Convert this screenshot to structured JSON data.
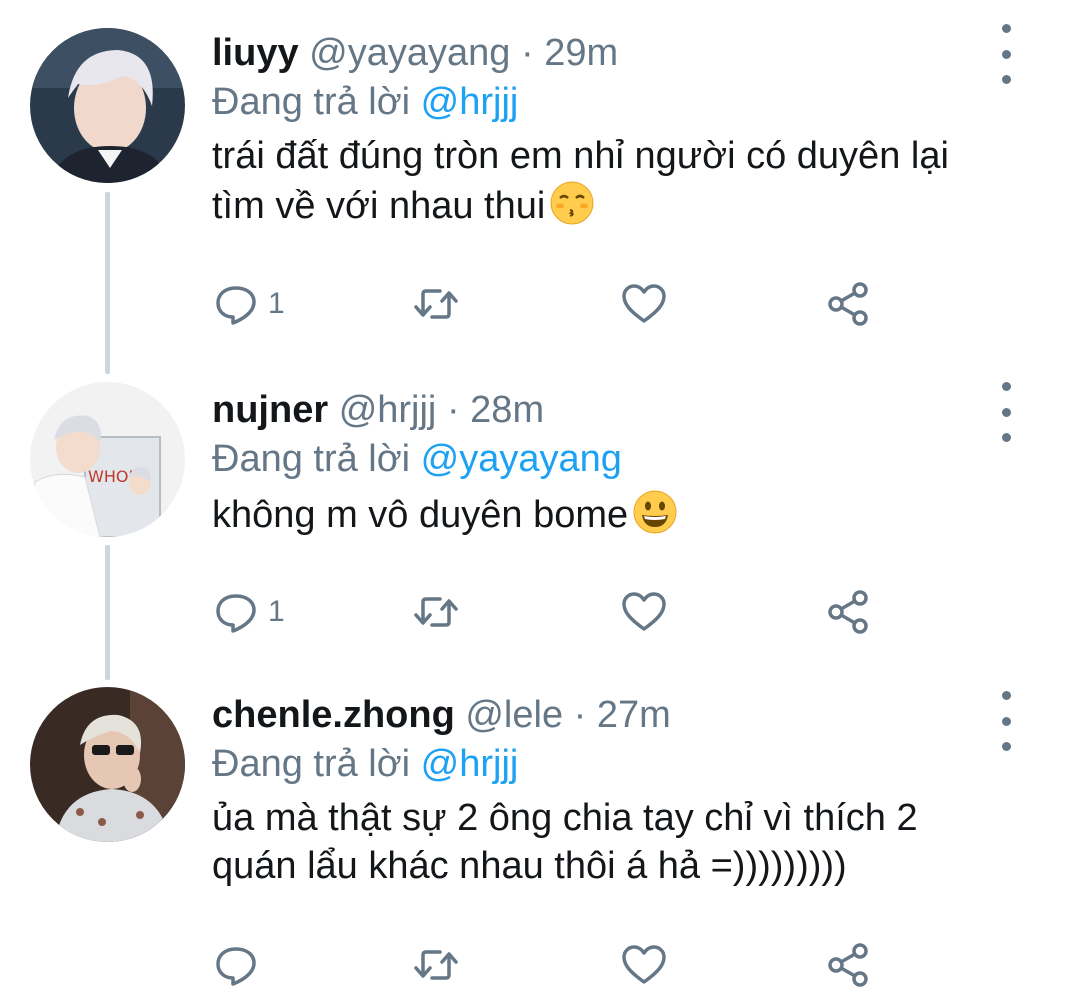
{
  "colors": {
    "text": "#14171a",
    "muted": "#657786",
    "link": "#1da1f2",
    "thread_line": "#ccd6dd"
  },
  "tweets": [
    {
      "name": "liuyy",
      "handle": "@yayayang",
      "separator": "·",
      "time": "29m",
      "reply_prefix": "Đang trả lời",
      "reply_handle": "@hrjjj",
      "text": "trái đất đúng tròn em nhỉ người có duyên lại tìm về với nhau thui",
      "emoji": "kissing-face-smiling-eyes-emoji",
      "reply_count": "1"
    },
    {
      "name": "nujner",
      "handle": "@hrjjj",
      "separator": "·",
      "time": "28m",
      "reply_prefix": "Đang trả lời",
      "reply_handle": "@yayayang",
      "text": "không m vô duyên bome",
      "emoji": "grinning-face-emoji",
      "reply_count": "1"
    },
    {
      "name": "chenle.zhong",
      "handle": "@lele",
      "separator": "·",
      "time": "27m",
      "reply_prefix": "Đang trả lời",
      "reply_handle": "@hrjjj",
      "text": "ủa mà thật sự 2 ông chia tay chỉ vì thích 2 quán lẩu khác nhau thôi á hả =)))))))))",
      "emoji": "",
      "reply_count": ""
    }
  ],
  "icons": [
    "reply-icon",
    "retweet-icon",
    "like-icon",
    "share-icon",
    "more-options-icon"
  ]
}
